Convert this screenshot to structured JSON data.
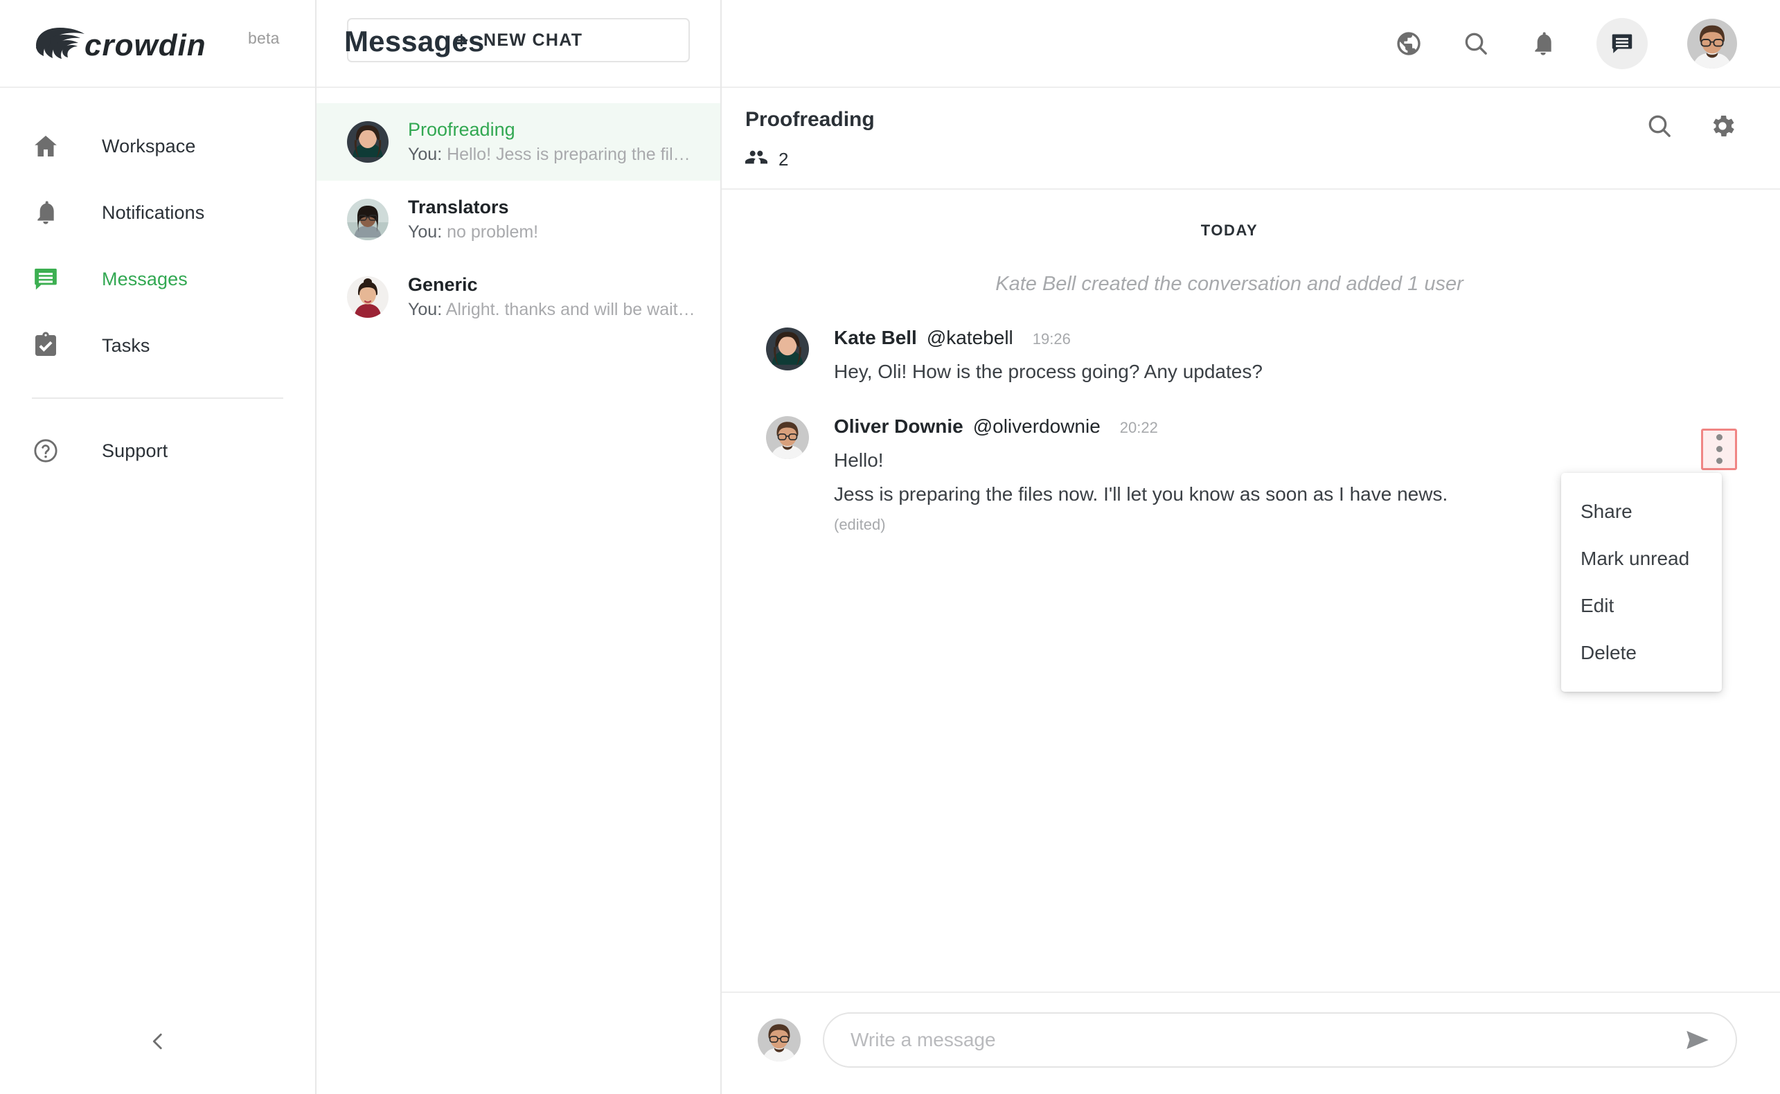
{
  "brand": {
    "name": "crowdin",
    "badge": "beta"
  },
  "sidebar": {
    "items": [
      {
        "label": "Workspace",
        "icon": "home-icon",
        "active": false
      },
      {
        "label": "Notifications",
        "icon": "bell-icon",
        "active": false
      },
      {
        "label": "Messages",
        "icon": "message-icon",
        "active": true
      },
      {
        "label": "Tasks",
        "icon": "clipboard-check-icon",
        "active": false
      }
    ],
    "support": {
      "label": "Support",
      "icon": "help-circle-icon"
    },
    "collapse_icon": "chevron-left-icon"
  },
  "header": {
    "title": "Messages",
    "icons": [
      "globe-icon",
      "search-icon",
      "bell-icon",
      "message-icon",
      "user-avatar"
    ]
  },
  "chat_panel": {
    "new_chat_label": "NEW CHAT",
    "new_chat_icon": "plus-icon",
    "chats": [
      {
        "title": "Proofreading",
        "prefix": "You:",
        "snippet": "Hello! Jess is preparing the fil…",
        "active": true
      },
      {
        "title": "Translators",
        "prefix": "You:",
        "snippet": "no problem!",
        "active": false
      },
      {
        "title": "Generic",
        "prefix": "You:",
        "snippet": "Alright. thanks and will be wait…",
        "active": false
      }
    ]
  },
  "conversation": {
    "name": "Proofreading",
    "members_icon": "people-icon",
    "members_count": "2",
    "search_icon": "search-icon",
    "settings_icon": "gear-icon",
    "day_separator": "TODAY",
    "system_message": "Kate Bell created the conversation and added 1 user",
    "messages": [
      {
        "author": "Kate Bell",
        "handle": "@katebell",
        "time": "19:26",
        "lines": [
          "Hey, Oli! How is the process going? Any updates?"
        ],
        "edited": null
      },
      {
        "author": "Oliver Downie",
        "handle": "@oliverdownie",
        "time": "20:22",
        "lines": [
          "Hello!",
          "Jess is preparing the files now. I'll let you know as soon as I have news."
        ],
        "edited": "(edited)"
      }
    ]
  },
  "message_menu": {
    "trigger_icon": "kebab-menu-icon",
    "items": [
      "Share",
      "Mark unread",
      "Edit",
      "Delete"
    ]
  },
  "composer": {
    "placeholder": "Write a message",
    "value": "",
    "send_icon": "send-icon"
  },
  "colors": {
    "accent_green": "#32a852",
    "active_row_bg": "#f2f9f4",
    "highlight_border": "#f08584",
    "highlight_bg": "#fdeeee",
    "text_primary": "#2b3137",
    "text_muted": "#a7a9ac"
  }
}
